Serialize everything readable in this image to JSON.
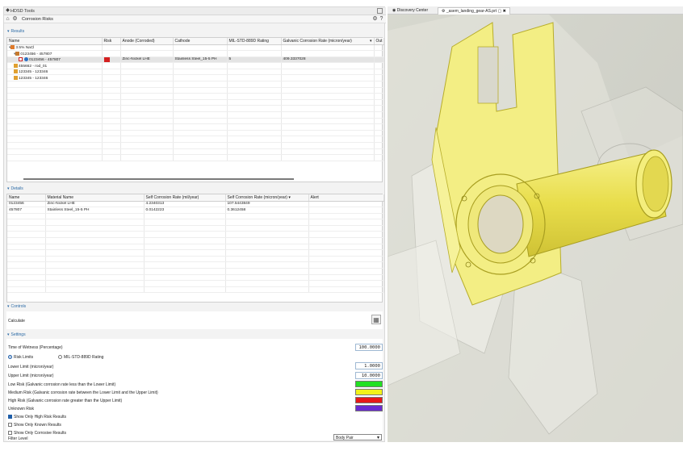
{
  "app": {
    "title": "HDSD Tools",
    "panel_title": "Corrosion Risks"
  },
  "results": {
    "section": "Results",
    "columns": [
      "Name",
      "Risk",
      "Anode (Corroded)",
      "Cathode",
      "MIL-STD-889D Rating",
      "Galvanic Corrosion Rate (micron/year)",
      "Out"
    ],
    "rows": [
      {
        "name": "3.5% NaCl",
        "risk": "",
        "anode": "",
        "cathode": "",
        "rating": "",
        "rate": ""
      },
      {
        "name": "0123456 - 457807",
        "risk": "",
        "anode": "",
        "cathode": "",
        "rating": "",
        "rate": ""
      },
      {
        "name": "0123456 - 457807",
        "risk": "red",
        "anode": "Zinc-Nickel LHE",
        "cathode": "Stainless Steel_15-5 PH",
        "rating": "5",
        "rate": "409.3337028"
      },
      {
        "name": "455662 - rod_01",
        "risk": "",
        "anode": "",
        "cathode": "",
        "rating": "",
        "rate": ""
      },
      {
        "name": "123345 - 123346",
        "risk": "",
        "anode": "",
        "cathode": "",
        "rating": "",
        "rate": ""
      },
      {
        "name": "123345 - 123346",
        "risk": "",
        "anode": "",
        "cathode": "",
        "rating": "",
        "rate": ""
      }
    ]
  },
  "details": {
    "section": "Details",
    "columns": [
      "Name",
      "Material Name",
      "Self Corrosion Rate (mil/year)",
      "Self Corrosion Rate (micron/year)",
      "Alert"
    ],
    "rows": [
      {
        "name": "0123456",
        "material": "Zinc-Nickel LHE",
        "mil": "4.2340313",
        "micron": "107.5443849",
        "alert": ""
      },
      {
        "name": "457807",
        "material": "Stainless Steel_15-5 PH",
        "mil": "0.0142223",
        "micron": "0.3612458",
        "alert": ""
      }
    ]
  },
  "controls": {
    "section": "Controls",
    "calculate": "Calculate"
  },
  "settings": {
    "section": "Settings",
    "time_of_wetness_label": "Time of Wetness (Percentage)",
    "time_of_wetness_value": "100.0000",
    "radio_risk_limits": "Risk Limits",
    "radio_mil_std": "MIL-STD-889D Rating",
    "lower_limit_label": "Lower Limit (micron/year)",
    "lower_limit_value": "1.0000",
    "upper_limit_label": "Upper Limit (micron/year)",
    "upper_limit_value": "10.0000",
    "low_risk_label": "Low Risk (Galvanic corrosion rate less than the Lower Limit)",
    "medium_risk_label": "Medium Risk (Galvanic corrosion rate between the Lower Limit and the Upper Limit)",
    "high_risk_label": "High Risk (Galvanic corrosion rate greater than the Upper Limit)",
    "unknown_risk_label": "Unknown Risk",
    "show_high_risk": "Show Only High Risk Results",
    "show_known_risk": "Show Only Known Results",
    "show_corrosive": "Show Only Corrosive Results",
    "filter_level_label": "Filter Level",
    "filter_level_value": "Body Pair",
    "colors": {
      "low": "#22e022",
      "medium": "#f2f21a",
      "high": "#e81818",
      "unknown": "#6a2bd0"
    }
  },
  "viewport": {
    "tabs": [
      "Discovery Center",
      "_asem_landing_gear-AS.prt"
    ]
  }
}
